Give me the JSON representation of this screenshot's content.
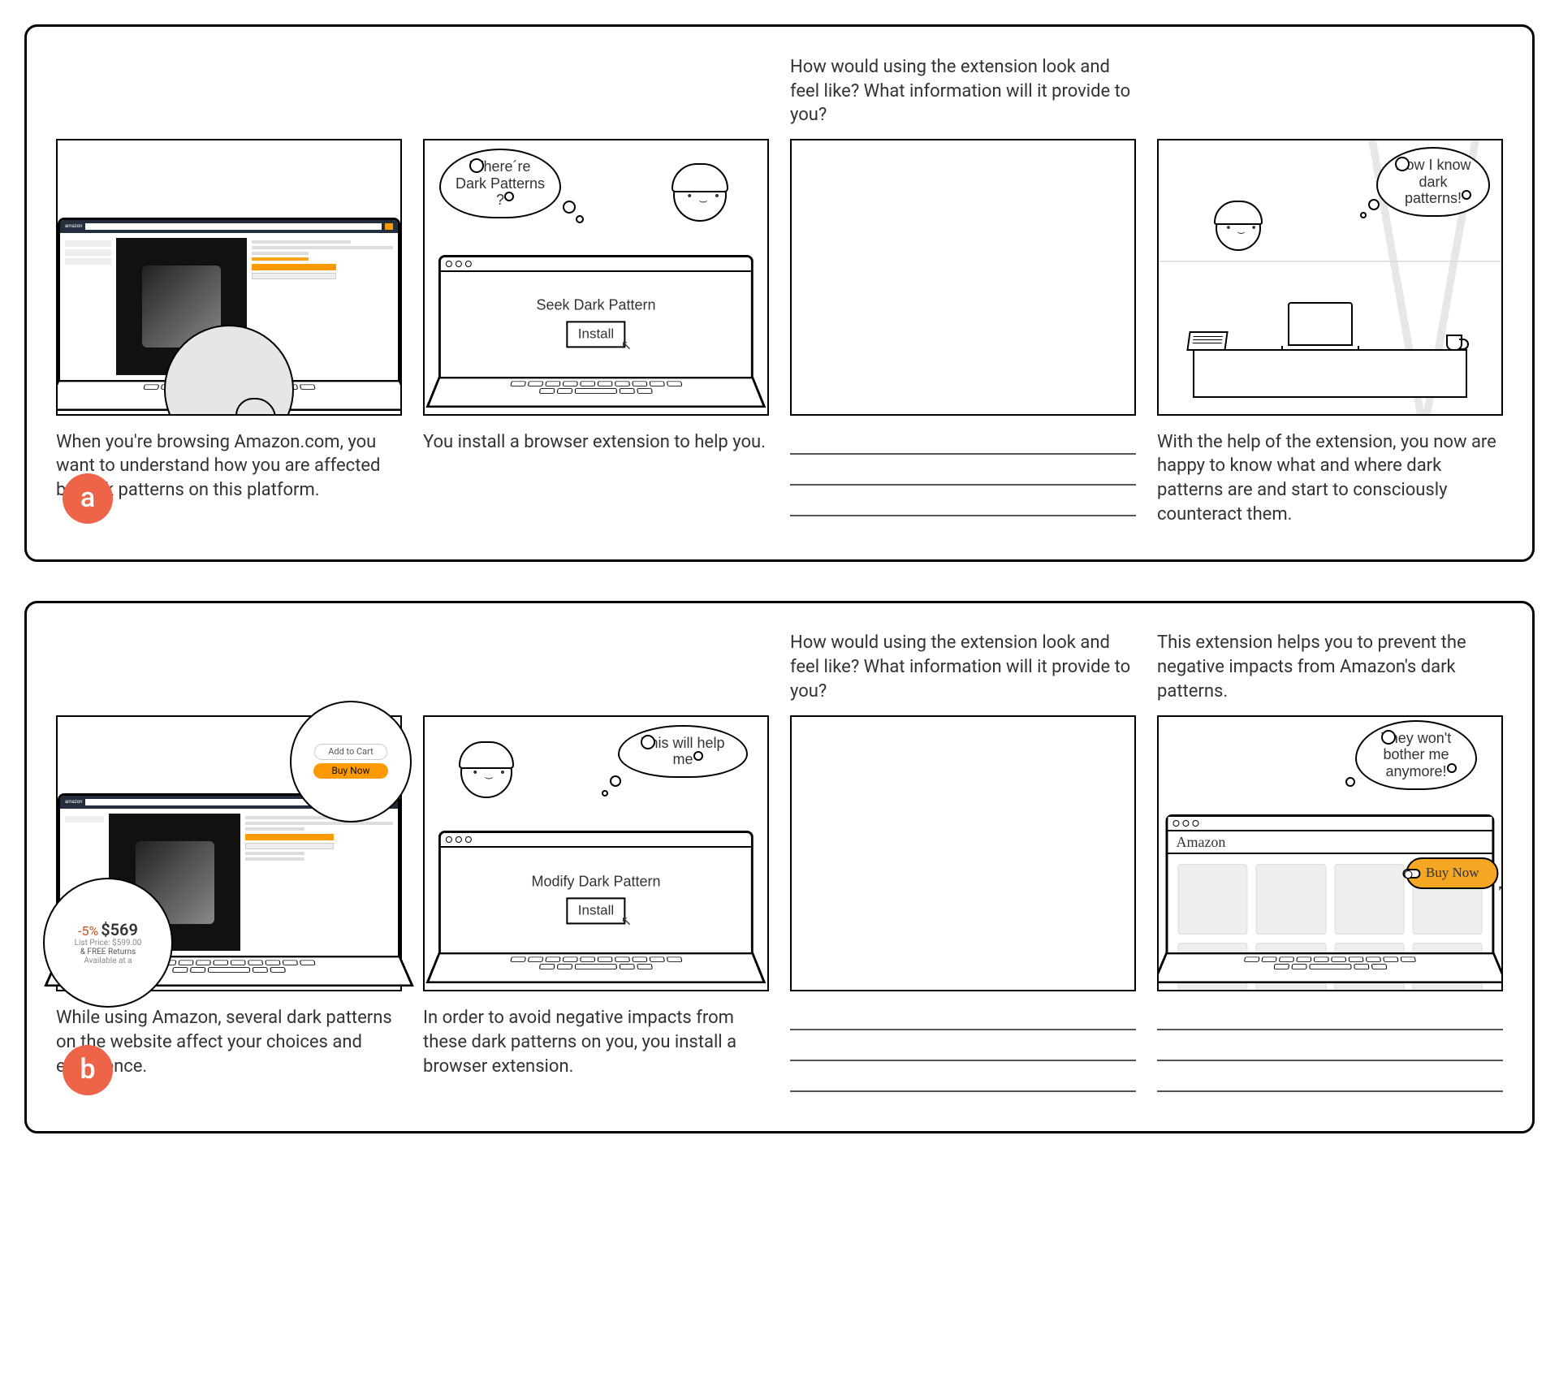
{
  "storyboards": {
    "a": {
      "badge": "a",
      "panels": [
        {
          "prompt": "",
          "caption": "When you're browsing Amazon.com, you want to understand how you are affected by dark patterns on this platform."
        },
        {
          "prompt": "",
          "thought": "Where´re Dark Patterns ?",
          "window_title": "Seek Dark Pattern",
          "button": "Install",
          "caption": "You install a browser extension to help you."
        },
        {
          "prompt": "How would using the extension look and feel like?  What information will it provide to you?",
          "caption": ""
        },
        {
          "prompt": "",
          "thought": "Now I know dark patterns!",
          "caption": "With the help of the extension, you now are happy to know what and where dark patterns are and start to consciously counteract them."
        }
      ]
    },
    "b": {
      "badge": "b",
      "panels": [
        {
          "prompt": "",
          "zoom_top": {
            "addcart": "Add to Cart",
            "buynow": "Buy Now"
          },
          "zoom_bottom": {
            "discount": "-5%",
            "price": "$569",
            "list": "List Price: $599.00",
            "returns": "& FREE Returns",
            "avail": "Available at a"
          },
          "caption": "While using Amazon, several dark patterns on the website affect your choices and experience."
        },
        {
          "prompt": "",
          "thought": "This will help me",
          "window_title": "Modify Dark Pattern",
          "button": "Install",
          "caption": "In order to avoid negative impacts from these dark patterns on you, you install a browser extension."
        },
        {
          "prompt": "How would using the extension look and feel like?  What information will it provide to you?",
          "caption": ""
        },
        {
          "prompt": "This extension helps you to prevent the negative impacts from Amazon's dark patterns.",
          "thought": "They won't bother me anymore!",
          "site_label": "Amazon",
          "buynow": "Buy Now",
          "caption": ""
        }
      ]
    }
  }
}
